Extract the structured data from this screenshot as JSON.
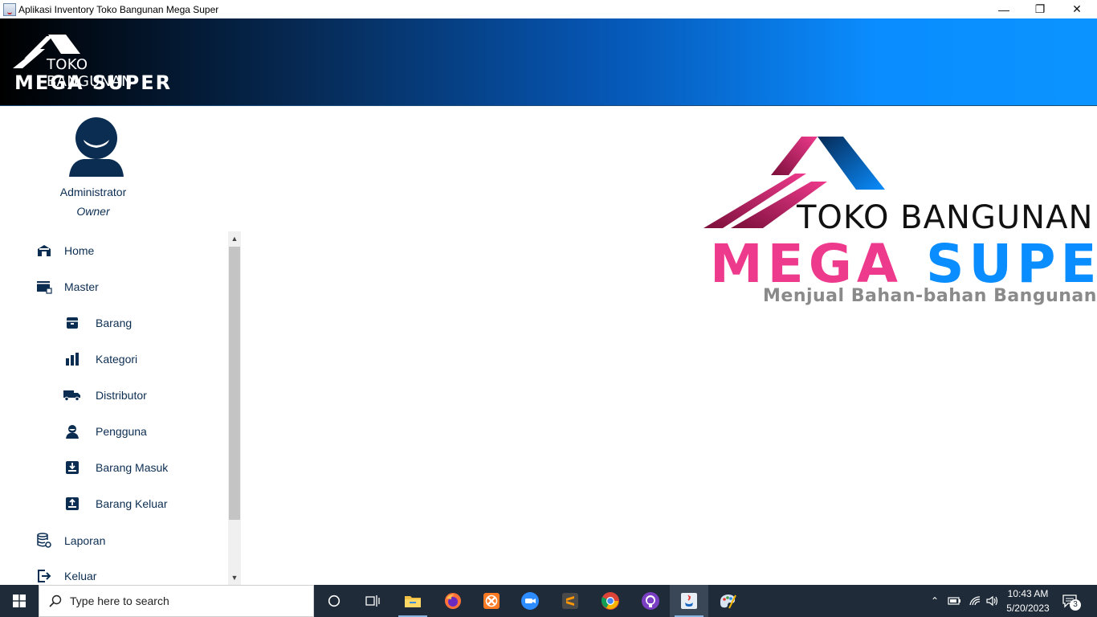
{
  "window": {
    "title": "Aplikasi Inventory Toko Bangunan Mega Super",
    "minimize": "—",
    "restore": "❐",
    "close": "✕"
  },
  "header": {
    "logo_line1": "TOKO BANGUNAN",
    "logo_line2": "MEGA SUPER"
  },
  "profile": {
    "name": "Administrator",
    "role": "Owner"
  },
  "menu": {
    "items": [
      {
        "label": "Home",
        "icon": "home-icon"
      },
      {
        "label": "Master",
        "icon": "folder-icon"
      },
      {
        "label": "Barang",
        "icon": "box-icon"
      },
      {
        "label": "Kategori",
        "icon": "bar-chart-icon"
      },
      {
        "label": "Distributor",
        "icon": "truck-icon"
      },
      {
        "label": "Pengguna",
        "icon": "user-icon"
      },
      {
        "label": "Barang Masuk",
        "icon": "inbox-in-icon"
      },
      {
        "label": "Barang Keluar",
        "icon": "inbox-out-icon"
      },
      {
        "label": "Laporan",
        "icon": "database-gear-icon"
      },
      {
        "label": "Keluar",
        "icon": "logout-icon"
      }
    ]
  },
  "main_logo": {
    "line1": "TOKO BANGUNAN",
    "mega": "MEGA",
    "super": "SUPER",
    "tagline": "Menjual Bahan-bahan Bangunan"
  },
  "taskbar": {
    "search_placeholder": "Type here to search",
    "time": "10:43 AM",
    "date": "5/20/2023",
    "notification_count": "3"
  },
  "colors": {
    "accent_dark": "#0b2d52",
    "pink": "#ee3a8c",
    "blue": "#0a8dff"
  }
}
